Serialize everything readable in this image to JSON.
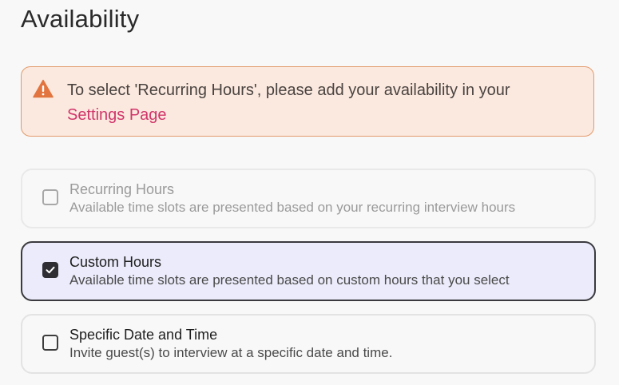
{
  "page": {
    "title": "Availability"
  },
  "alert": {
    "icon": "warning-icon",
    "message": "To select 'Recurring Hours', please add your availability in your",
    "link_label": "Settings Page",
    "color": "#e2743f"
  },
  "options": [
    {
      "label": "Recurring Hours",
      "description": "Available time slots are presented based on your recurring interview hours",
      "checked": false,
      "disabled": true
    },
    {
      "label": "Custom Hours",
      "description": "Available time slots are presented based on custom hours that you select",
      "checked": true,
      "disabled": false
    },
    {
      "label": "Specific Date and Time",
      "description": "Invite guest(s) to interview at a specific date and time.",
      "checked": false,
      "disabled": false
    }
  ],
  "colors": {
    "link": "#d1356a",
    "selected_background": "#ebebfb",
    "alert_background": "#fbe9df"
  }
}
